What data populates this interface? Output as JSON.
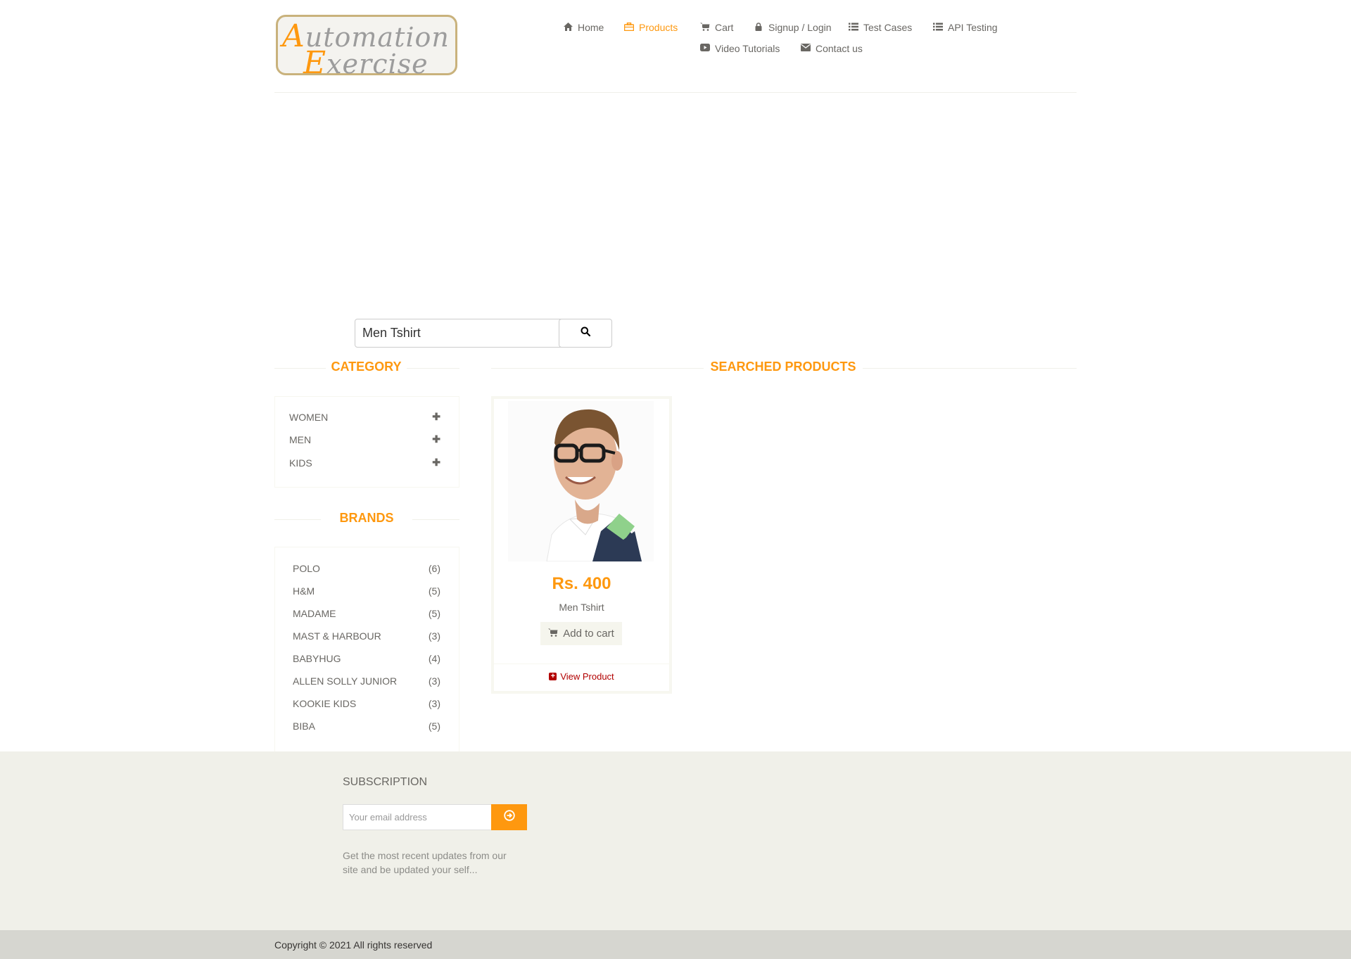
{
  "logo": {
    "line1_cap": "A",
    "line1_rest": "utomation",
    "line2_cap": "E",
    "line2_rest": "xercise"
  },
  "nav": {
    "home": "Home",
    "products": "Products",
    "cart": "Cart",
    "signup_login": "Signup / Login",
    "test_cases": "Test Cases",
    "api_testing": "API Testing",
    "video_tutorials": "Video Tutorials",
    "contact_us": "Contact us"
  },
  "search": {
    "value": "Men Tshirt"
  },
  "sidebar": {
    "category_title": "Category",
    "categories": [
      "WOMEN",
      "MEN",
      "KIDS"
    ],
    "brands_title": "Brands",
    "brands": [
      {
        "name": "POLO",
        "count": "(6)"
      },
      {
        "name": "H&M",
        "count": "(5)"
      },
      {
        "name": "MADAME",
        "count": "(5)"
      },
      {
        "name": "MAST & HARBOUR",
        "count": "(3)"
      },
      {
        "name": "BABYHUG",
        "count": "(4)"
      },
      {
        "name": "ALLEN SOLLY JUNIOR",
        "count": "(3)"
      },
      {
        "name": "KOOKIE KIDS",
        "count": "(3)"
      },
      {
        "name": "BIBA",
        "count": "(5)"
      }
    ]
  },
  "main": {
    "title": "Searched Products",
    "products": [
      {
        "price": "Rs. 400",
        "name": "Men Tshirt",
        "add_to_cart": "Add to cart",
        "view_product": "View Product"
      }
    ]
  },
  "footer": {
    "subscription_title": "Subscription",
    "email_placeholder": "Your email address",
    "description": "Get the most recent updates from our site and be updated your self...",
    "copyright": "Copyright © 2021 All rights reserved"
  },
  "colors": {
    "accent": "#fe980f",
    "text": "#696763",
    "footer_bg": "#f0f0e9",
    "link_red": "#b20000"
  }
}
